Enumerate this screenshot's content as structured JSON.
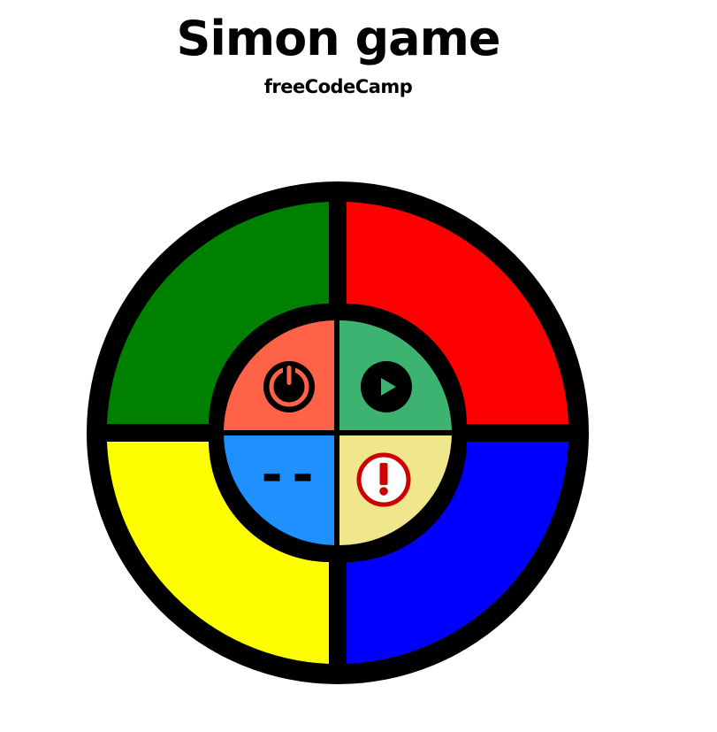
{
  "header": {
    "title": "Simon game",
    "subtitle": "freeCodeCamp"
  },
  "colors": {
    "green": "#008000",
    "red": "#ff0000",
    "yellow": "#ffff00",
    "blue": "#0000ff",
    "power_button": "#ff6347",
    "start_button": "#3cb371",
    "count_display": "#1e90ff",
    "strict_button": "#f0e68c",
    "strict_icon": "#cc0000",
    "border": "#000000"
  },
  "controls": {
    "count_display": "--",
    "power_icon": "power-icon",
    "start_icon": "play-icon",
    "strict_icon": "exclamation-icon"
  }
}
